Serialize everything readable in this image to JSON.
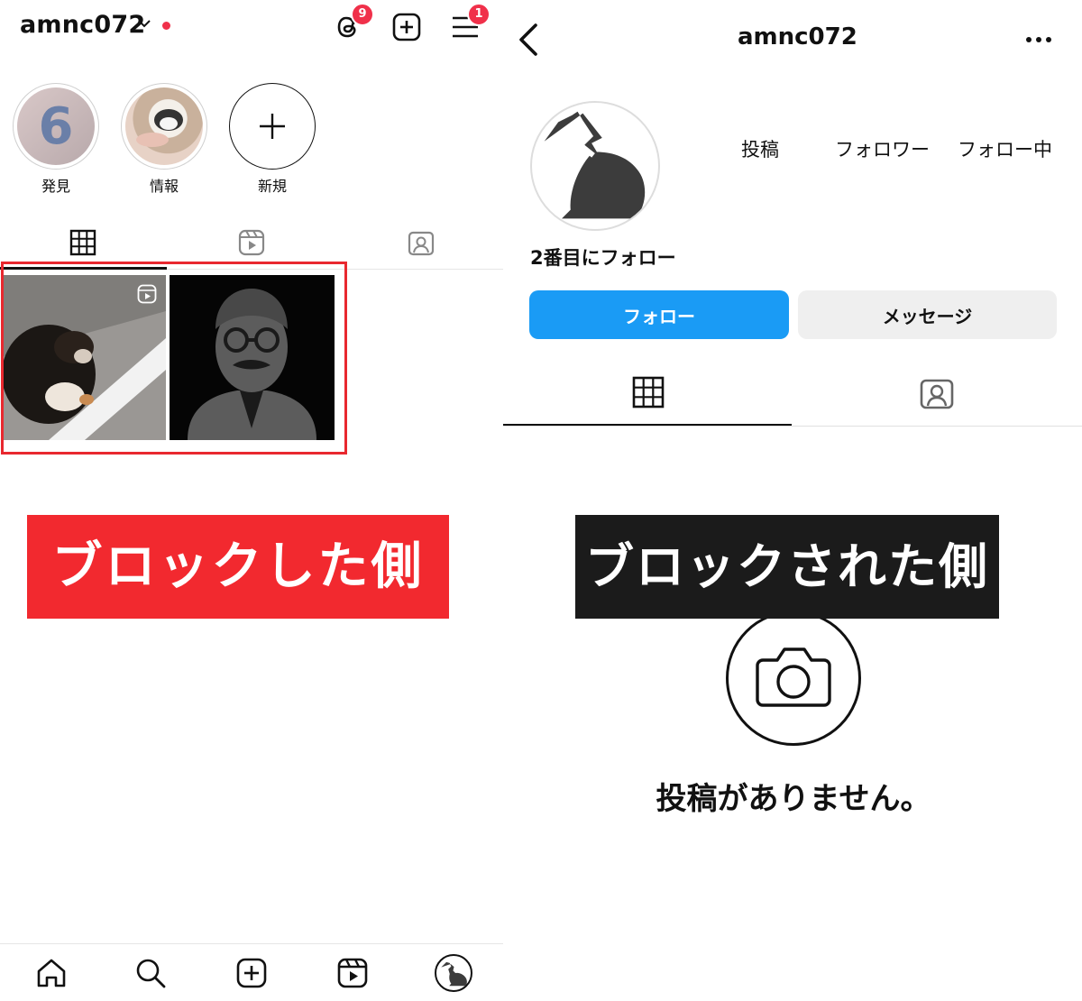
{
  "left": {
    "username": "amnc072",
    "threads_badge": "9",
    "menu_badge": "1",
    "highlights": [
      {
        "label": "発見"
      },
      {
        "label": "情報"
      },
      {
        "label": "新規"
      }
    ],
    "annotation": "ブロックした側"
  },
  "right": {
    "username": "amnc072",
    "stats": {
      "posts": "投稿",
      "followers": "フォロワー",
      "following": "フォロー中"
    },
    "bio": "2番目にフォロー",
    "follow_button": "フォロー",
    "message_button": "メッセージ",
    "annotation": "ブロックされた側",
    "empty_message": "投稿がありません。"
  },
  "colors": {
    "follow_blue": "#1a9bf5",
    "badge_red": "#f0304a",
    "annotation_red": "#f2292f",
    "annotation_black": "#1b1b1b"
  }
}
